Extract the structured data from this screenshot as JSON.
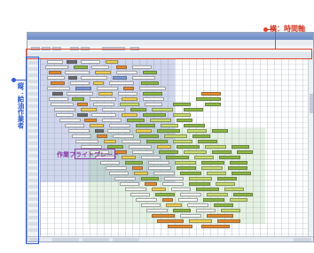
{
  "annotations": {
    "time_axis_label": "横：時間軸",
    "vertical_label": "縦：給油作業者",
    "flight_label": "作業フライトプレート"
  },
  "colors": {
    "annotation_red": "#e2422c",
    "annotation_blue": "#2f5ccc",
    "annotation_purple": "#8a3fa7",
    "bar_white": "#ffffff",
    "bar_yellow": "#f3d250",
    "bar_green": "#8dbb3f",
    "bar_orange": "#e98b2a",
    "bar_blue": "#7f9be0",
    "bar_gray": "#6a6a6a"
  },
  "window": {
    "icons": [
      "app-icon",
      "minimize-icon",
      "maximize-icon",
      "close-icon"
    ]
  }
}
